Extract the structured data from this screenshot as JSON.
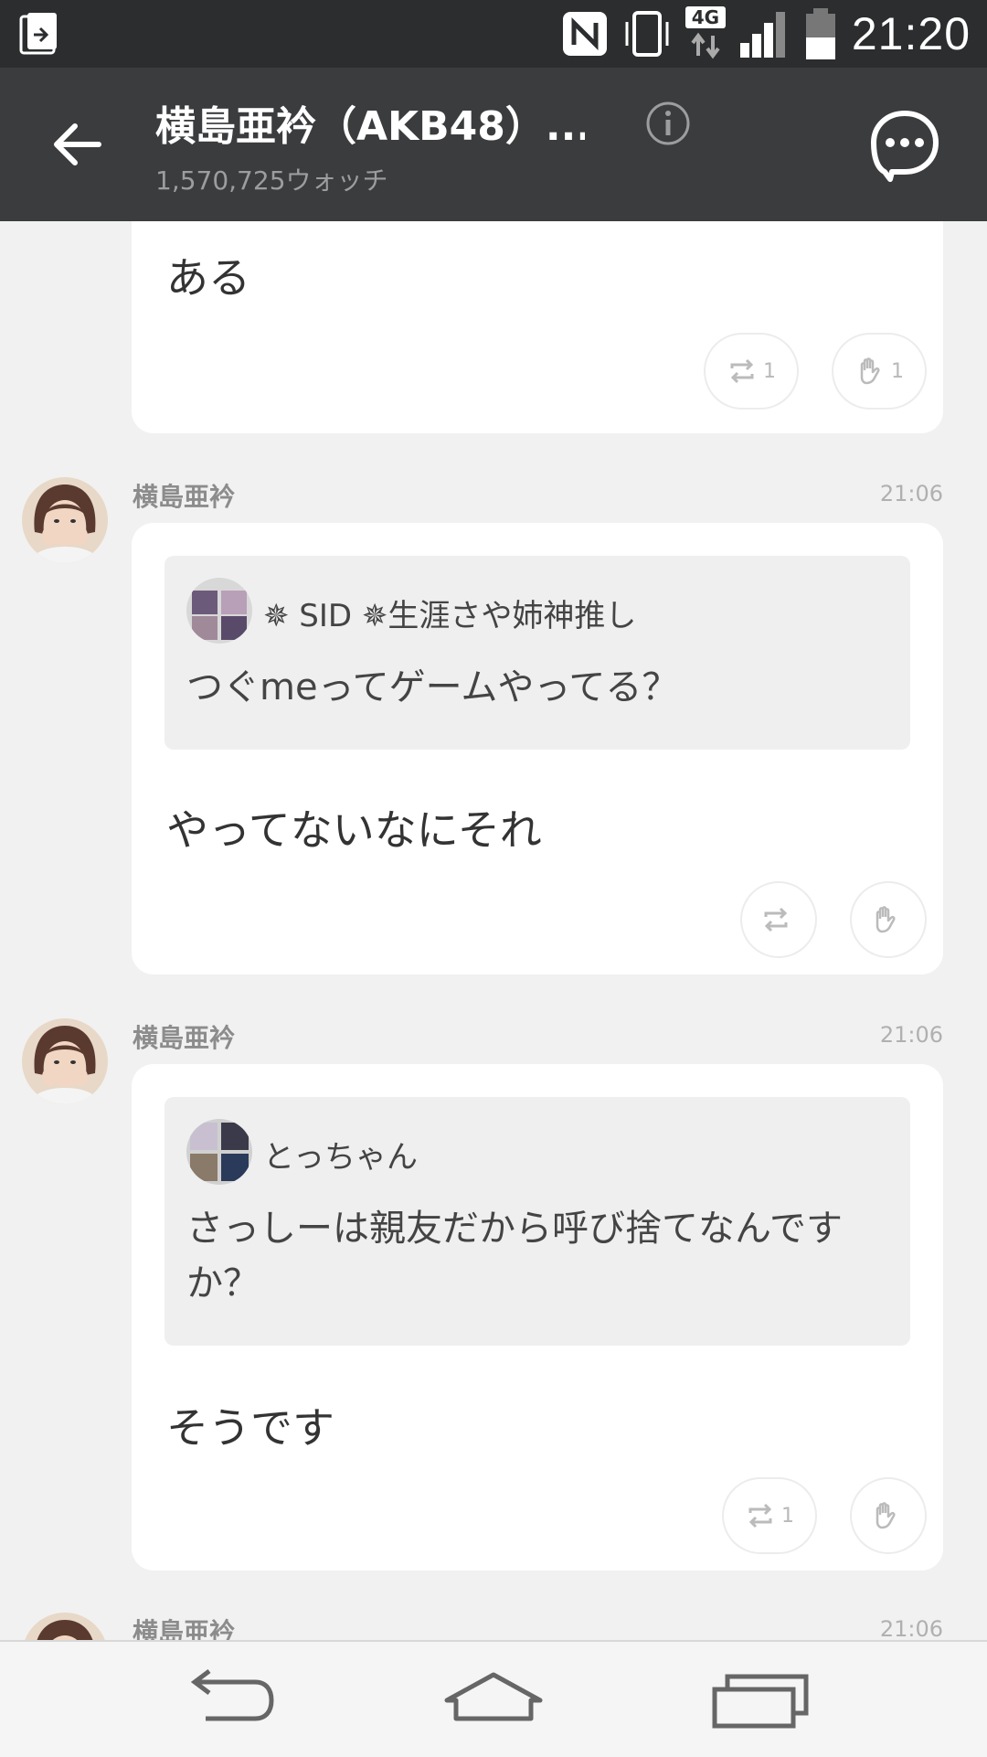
{
  "status_bar": {
    "time": "21:20",
    "network": "4G",
    "icons": [
      "app-switch-icon",
      "nfc-icon",
      "vibrate-icon",
      "network-4g-icon",
      "signal-icon",
      "battery-icon"
    ]
  },
  "header": {
    "title": "横島亜衿（AKB48）...",
    "subtitle": "1,570,725ウォッチ",
    "icons": [
      "back-arrow-icon",
      "info-icon",
      "chat-bubble-icon"
    ]
  },
  "messages": [
    {
      "text": "ある",
      "repost_count": "1",
      "like_count": "1"
    },
    {
      "sender": "横島亜衿",
      "time": "21:06",
      "quote": {
        "name": "✵ SID ✵生涯さや姉神推し",
        "text": "つぐmeってゲームやってる？"
      },
      "text": "やってないなにそれ",
      "repost_count": "",
      "like_count": ""
    },
    {
      "sender": "横島亜衿",
      "time": "21:06",
      "quote": {
        "name": "とっちゃん",
        "text": "さっしーは親友だから呼び捨てなんですか？"
      },
      "text": "そうです",
      "repost_count": "1",
      "like_count": ""
    },
    {
      "sender": "横島亜衿",
      "time": "21:06"
    }
  ],
  "colors": {
    "status_bar_bg": "#2b2d2e",
    "header_bg": "#3a3c3e",
    "page_bg": "#f1f1f1",
    "card_bg": "#ffffff",
    "quote_bg": "#efefef"
  },
  "nav_bar": {
    "icons": [
      "nav-back-icon",
      "nav-home-icon",
      "nav-recents-icon"
    ]
  }
}
